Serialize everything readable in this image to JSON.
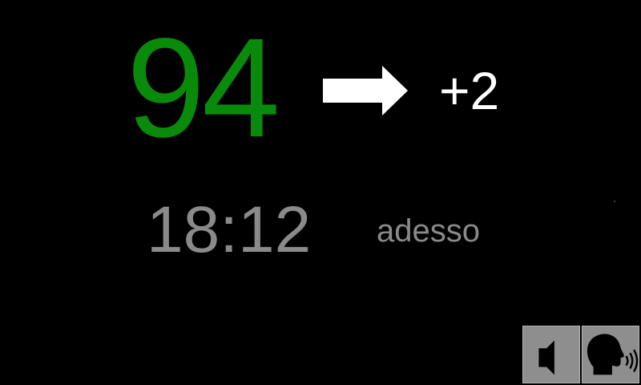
{
  "reading": {
    "value": "94",
    "value_color": "#0a8a0a",
    "trend_icon": "arrow-right-icon",
    "delta": "+2",
    "time": "18:12",
    "time_ago": "adesso"
  },
  "controls": {
    "mute_icon": "speaker-mute-icon",
    "speak_icon": "speaking-head-icon"
  },
  "colors": {
    "background": "#000000",
    "secondary_text": "#8a8a8a",
    "button_bg": "#8e8e8e"
  }
}
